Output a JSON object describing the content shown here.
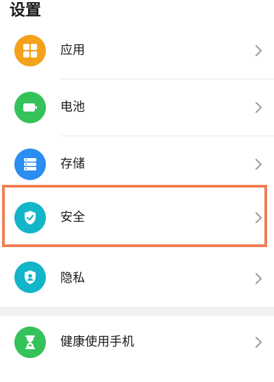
{
  "header": {
    "title": "设置"
  },
  "items": [
    {
      "label": "应用",
      "icon": "apps-grid-icon",
      "color": "#f4a11b"
    },
    {
      "label": "电池",
      "icon": "battery-icon",
      "color": "#35c25a"
    },
    {
      "label": "存储",
      "icon": "storage-icon",
      "color": "#2a8ef0"
    },
    {
      "label": "安全",
      "icon": "shield-check-icon",
      "color": "#13b5c8"
    },
    {
      "label": "隐私",
      "icon": "privacy-shield-icon",
      "color": "#13b5c8"
    },
    {
      "label": "健康使用手机",
      "icon": "hourglass-icon",
      "color": "#35c25a"
    }
  ],
  "highlight": {
    "color": "#ef7d52",
    "target": "安全"
  }
}
